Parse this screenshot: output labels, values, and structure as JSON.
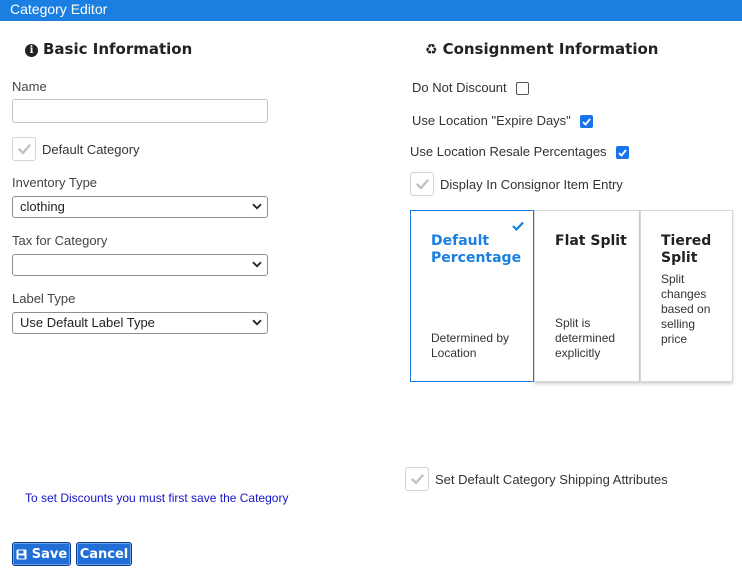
{
  "window": {
    "title": "Category Editor"
  },
  "basic": {
    "title": "Basic Information",
    "icon": "info-circle-icon",
    "name_label": "Name",
    "name_value": "",
    "default_category_label": "Default Category",
    "inventory_type_label": "Inventory Type",
    "inventory_type_value": "clothing",
    "tax_label": "Tax for Category",
    "tax_value": "",
    "label_type_label": "Label Type",
    "label_type_value": "Use Default Label Type"
  },
  "consignment": {
    "title": "Consignment Information",
    "icon": "recycle-icon",
    "do_not_discount": {
      "label": "Do Not Discount",
      "checked": false
    },
    "use_expire_days": {
      "label": "Use Location \"Expire Days\"",
      "checked": true
    },
    "use_resale_pct": {
      "label": "Use Location Resale Percentages",
      "checked": true
    },
    "display_in_entry": {
      "label": "Display In Consignor Item Entry",
      "checked": true
    },
    "split_cards": [
      {
        "title": "Default Percentage",
        "description": "Determined by Location",
        "selected": true
      },
      {
        "title": "Flat Split",
        "description": "Split is determined explicitly",
        "selected": false
      },
      {
        "title": "Tiered Split",
        "description": "Split changes based on selling price",
        "selected": false
      }
    ],
    "shipping_label": "Set Default Category Shipping Attributes"
  },
  "discount_note": "To set Discounts you must first save the Category",
  "buttons": {
    "save": "Save",
    "cancel": "Cancel"
  },
  "colors": {
    "accent": "#1a7fe0",
    "checkbox": "#1a73e8",
    "note": "#1515c8",
    "button": "#1f6fd6"
  }
}
